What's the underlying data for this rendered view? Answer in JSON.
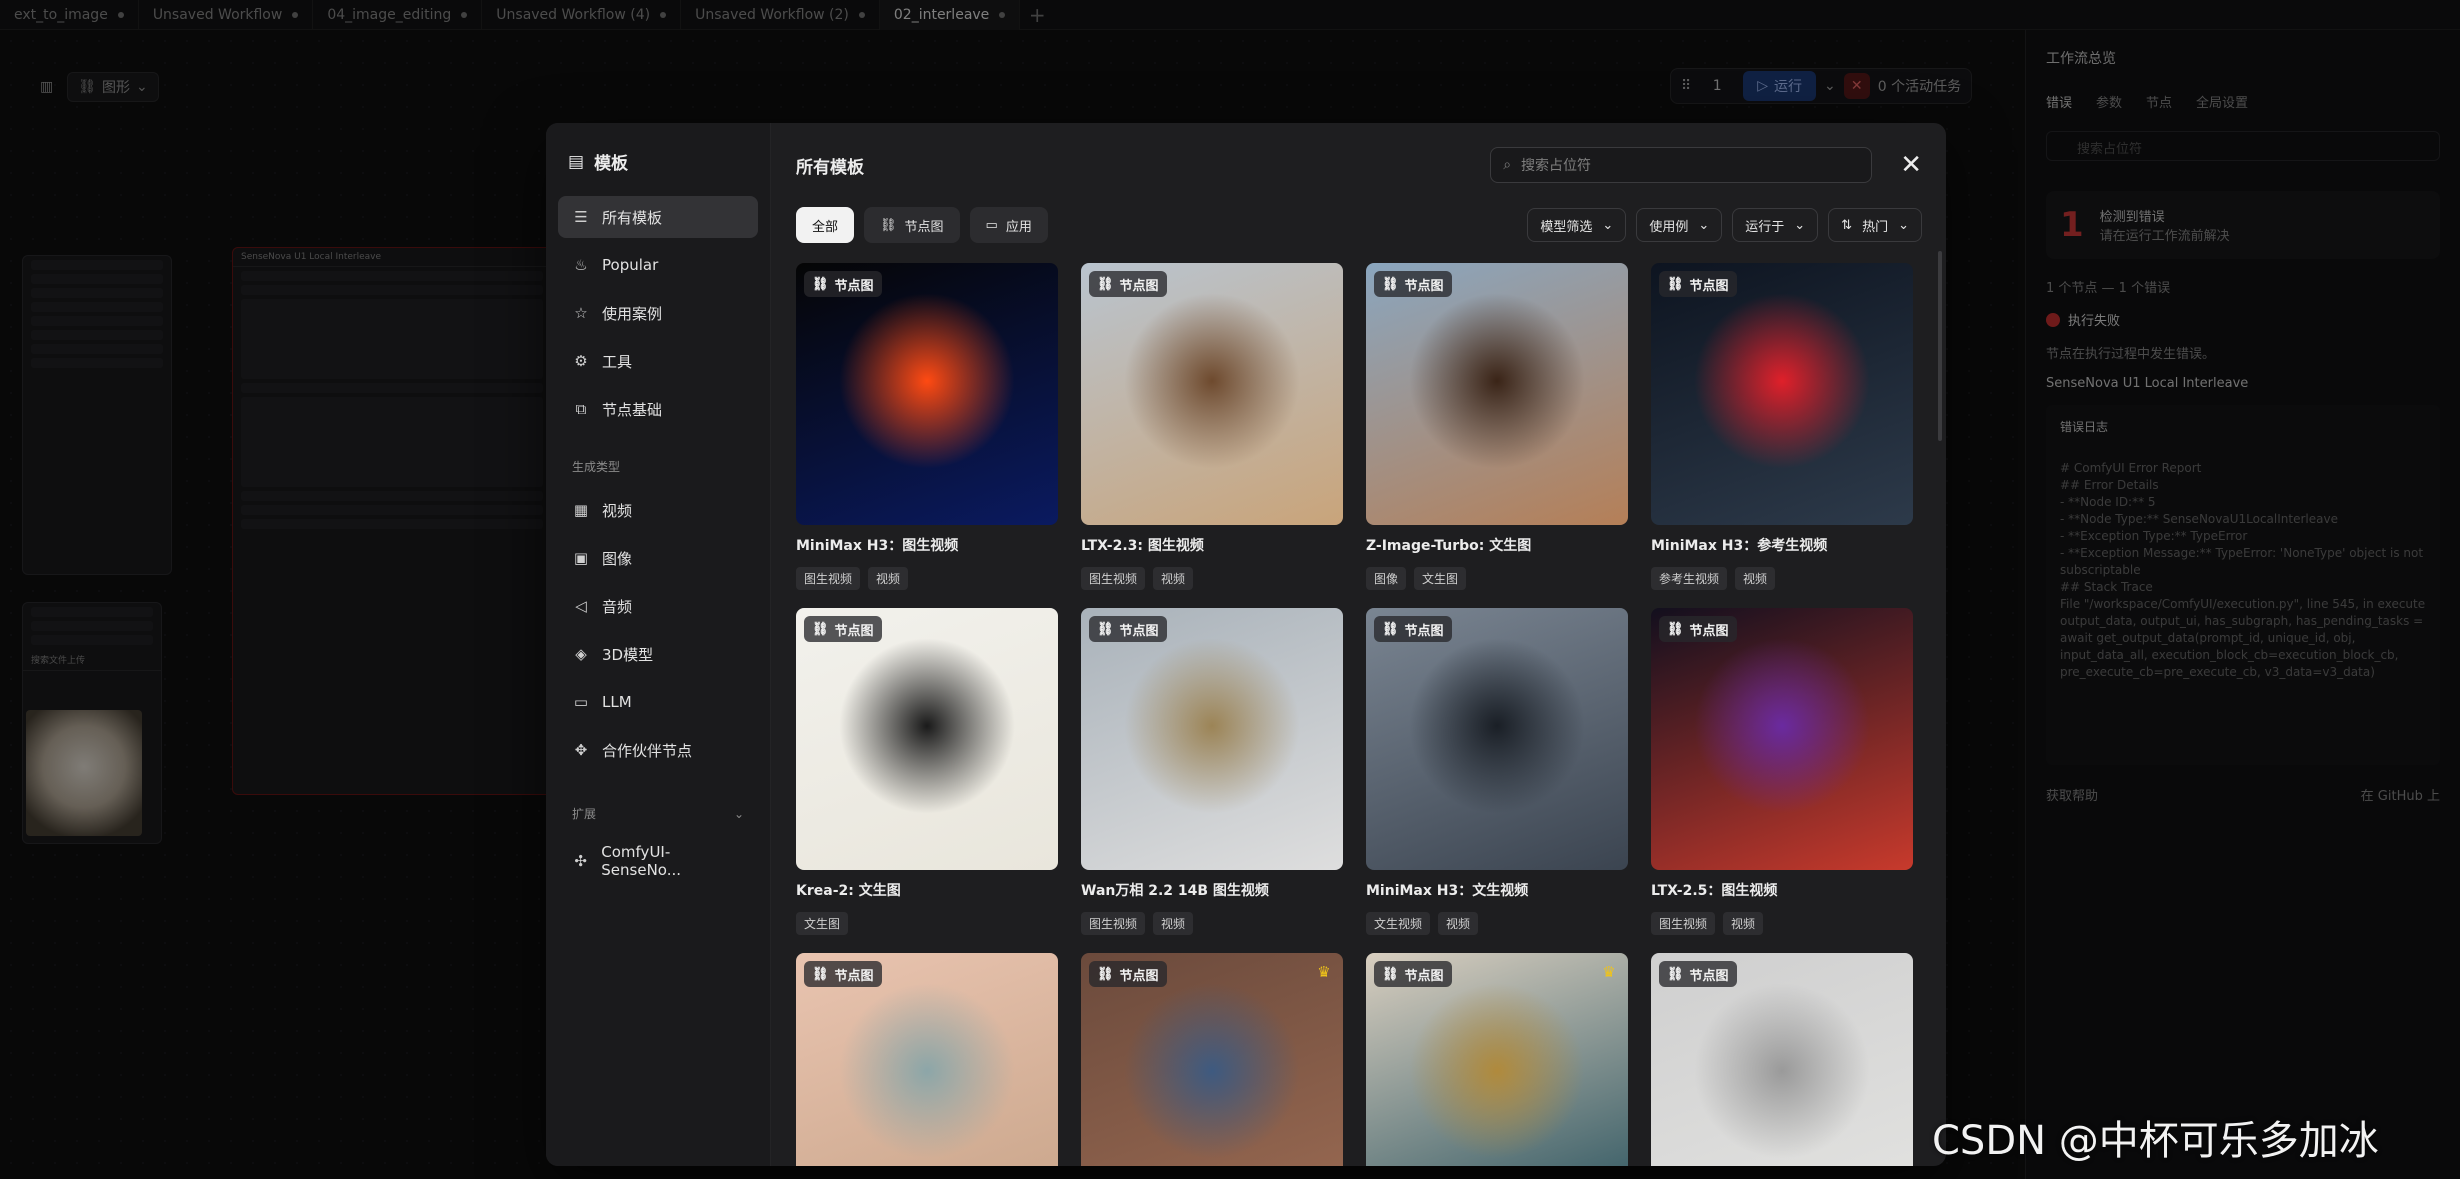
{
  "tabs": [
    {
      "label": "ext_to_image"
    },
    {
      "label": "Unsaved Workflow"
    },
    {
      "label": "04_image_editing"
    },
    {
      "label": "Unsaved Workflow (4)"
    },
    {
      "label": "Unsaved Workflow (2)"
    },
    {
      "label": "02_interleave"
    }
  ],
  "canvas": {
    "mode_label": "图形",
    "node_title": "SenseNova U1 Local Interleave",
    "dog_caption": "搜索文件上传"
  },
  "runbar": {
    "qty": "1",
    "run_label": "运行",
    "tasks": "0 个活动任务"
  },
  "sidepanel": {
    "title": "工作流总览",
    "tabs": [
      "错误",
      "参数",
      "节点",
      "全局设置"
    ],
    "search_placeholder": "搜索占位符",
    "error_count": "1",
    "error_title": "检测到错误",
    "error_sub": "请在运行工作流前解决",
    "summary": "1 个节点 — 1 个错误",
    "fail_title": "执行失败",
    "fail_sub": "节点在执行过程中发生错误。",
    "node_name": "SenseNova U1 Local Interleave",
    "log_title": "错误日志",
    "log_lines": [
      "# ComfyUI Error Report",
      "## Error Details",
      "- **Node ID:** 5",
      "- **Node Type:** SenseNovaU1LocalInterleave",
      "- **Exception Type:** TypeError",
      "- **Exception Message:** TypeError: 'NoneType' object is not subscriptable",
      "## Stack Trace",
      "File \"/workspace/ComfyUI/execution.py\", line 545, in execute",
      "output_data, output_ui, has_subgraph, has_pending_tasks = await get_output_data(prompt_id, unique_id, obj, input_data_all, execution_block_cb=execution_block_cb, pre_execute_cb=pre_execute_cb, v3_data=v3_data)"
    ],
    "help_label": "获取帮助",
    "github_label": "在 GitHub 上"
  },
  "modal": {
    "logo_label": "模板",
    "title": "所有模板",
    "search_placeholder": "搜索占位符",
    "nav": [
      {
        "label": "所有模板",
        "icon": "list-icon"
      },
      {
        "label": "Popular",
        "icon": "flame-icon"
      },
      {
        "label": "使用案例",
        "icon": "star-icon"
      },
      {
        "label": "工具",
        "icon": "gear-icon"
      },
      {
        "label": "节点基础",
        "icon": "blocks-icon"
      }
    ],
    "section_label": "生成类型",
    "gen_types": [
      {
        "label": "视频",
        "icon": "film-icon"
      },
      {
        "label": "图像",
        "icon": "image-icon"
      },
      {
        "label": "音频",
        "icon": "speaker-icon"
      },
      {
        "label": "3D模型",
        "icon": "cube-icon"
      },
      {
        "label": "LLM",
        "icon": "chat-icon"
      },
      {
        "label": "合作伙伴节点",
        "icon": "handshake-icon"
      }
    ],
    "ext_label": "扩展",
    "ext_items": [
      {
        "label": "ComfyUI-SenseNo...",
        "icon": "puzzle-icon"
      }
    ],
    "chips": [
      {
        "label": "全部",
        "active": true
      },
      {
        "label": "节点图",
        "active": false
      },
      {
        "label": "应用",
        "active": false
      }
    ],
    "dropdowns": [
      {
        "label": "模型筛选"
      },
      {
        "label": "使用例"
      },
      {
        "label": "运行于"
      },
      {
        "label": "热门"
      }
    ],
    "badge_label": "节点图",
    "cards": [
      {
        "title": "MiniMax H3：图生视频",
        "tags": [
          "图生视频",
          "视频"
        ],
        "c1": "#050505",
        "c2": "#0a1a60",
        "c3": "#ff4a12",
        "crown": false
      },
      {
        "title": "LTX-2.3: 图生视频",
        "tags": [
          "图生视频",
          "视频"
        ],
        "c1": "#b9c4cf",
        "c2": "#c9a47a",
        "c3": "#6e4a2e",
        "crown": false
      },
      {
        "title": "Z-Image-Turbo: 文生图",
        "tags": [
          "图像",
          "文生图"
        ],
        "c1": "#8aa6bf",
        "c2": "#b57f57",
        "c3": "#3a2417",
        "crown": false
      },
      {
        "title": "MiniMax H3：参考生视频",
        "tags": [
          "参考生视频",
          "视频"
        ],
        "c1": "#0d1420",
        "c2": "#2d3a4a",
        "c3": "#e0202a",
        "crown": false
      },
      {
        "title": "Krea-2: 文生图",
        "tags": [
          "文生图"
        ],
        "c1": "#f2f1ec",
        "c2": "#e9e6dc",
        "c3": "#1a1a1a",
        "crown": false
      },
      {
        "title": "Wan万相 2.2 14B 图生视频",
        "tags": [
          "图生视频",
          "视频"
        ],
        "c1": "#a9b2ba",
        "c2": "#dedede",
        "c3": "#9c8456",
        "crown": false
      },
      {
        "title": "MiniMax H3：文生视频",
        "tags": [
          "文生视频",
          "视频"
        ],
        "c1": "#7a8592",
        "c2": "#3b4450",
        "c3": "#1a1f26",
        "crown": false
      },
      {
        "title": "LTX-2.5：图生视频",
        "tags": [
          "图生视频",
          "视频"
        ],
        "c1": "#120f1e",
        "c2": "#c83a2c",
        "c3": "#6a2aa0",
        "crown": false
      },
      {
        "title": "",
        "tags": [],
        "c1": "#e9c4b0",
        "c2": "#c9a58a",
        "c3": "#8ca6a8",
        "crown": false
      },
      {
        "title": "",
        "tags": [],
        "c1": "#6b4a3c",
        "c2": "#9a6a52",
        "c3": "#3e5a80",
        "crown": true
      },
      {
        "title": "",
        "tags": [],
        "c1": "#d9cfc0",
        "c2": "#2d5560",
        "c3": "#b08a3c",
        "crown": true
      },
      {
        "title": "",
        "tags": [],
        "c1": "#cfcfcf",
        "c2": "#e3e3e1",
        "c3": "#9a9a9a",
        "crown": false
      }
    ]
  },
  "watermark": "CSDN @中杯可乐多加冰"
}
